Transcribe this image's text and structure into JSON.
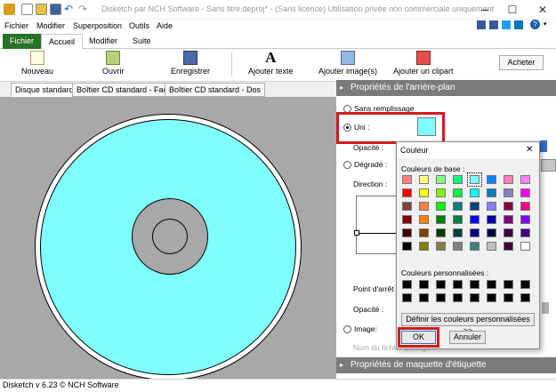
{
  "window": {
    "title": "Disketch par NCH Software - Sans titre.deproj* - (Sans licence) Utilisation privée non commerciale uniquement"
  },
  "menu": [
    "Fichier",
    "Modifier",
    "Superposition",
    "Outils",
    "Aide"
  ],
  "tabs": [
    "Fichier",
    "Accueil",
    "Modifier",
    "Suite"
  ],
  "ribbon": {
    "new": "Nouveau",
    "open": "Ouvrir",
    "save": "Enregistrer",
    "add_text": "Ajouter texte",
    "add_image": "Ajouter image(s)",
    "add_clipart": "Ajouter un clipart",
    "buy": "Acheter"
  },
  "doc_tabs": [
    "Disque standard",
    "Boîtier CD standard - Face",
    "Boîtier CD standard - Dos"
  ],
  "panel": {
    "bg_title": "Propriétés de l'arrière-plan",
    "no_fill": "Sans remplissage",
    "solid": "Uni :",
    "opacity": "Opacité :",
    "gradient": "Dégradé :",
    "direction": "Direction :",
    "stop_point": "Point d'arrêt :",
    "opacity2": "Opacité :",
    "image": "Image:",
    "filename": "Nom du fichier d'image",
    "label_title": "Propriétés de maquette d'étiquette"
  },
  "dialog": {
    "title": "Couleur",
    "base_colors": "Couleurs de base :",
    "custom_colors": "Couleurs personnalisées :",
    "define_button": "Définir les couleurs personnalisées >>",
    "ok": "OK",
    "cancel": "Annuler",
    "close": "✕"
  },
  "colors": {
    "disc": "#80ffff",
    "selected": "#80ffff",
    "file_tab": "#267226",
    "header": "#7b7b7b",
    "highlight": "#d01c1c",
    "base": [
      "#ff8080",
      "#ffff80",
      "#80ff80",
      "#00ff80",
      "#80ffff",
      "#0080ff",
      "#ff80c0",
      "#ff80ff",
      "#ff0000",
      "#ffff00",
      "#80ff00",
      "#00ff40",
      "#00ffff",
      "#0080c0",
      "#8080c0",
      "#ff00ff",
      "#804040",
      "#ff8040",
      "#00ff00",
      "#008080",
      "#004080",
      "#8080ff",
      "#800040",
      "#ff0080",
      "#800000",
      "#ff8000",
      "#008000",
      "#008040",
      "#0000ff",
      "#0000a0",
      "#800080",
      "#8000ff",
      "#400000",
      "#804000",
      "#004000",
      "#004040",
      "#000080",
      "#000040",
      "#400040",
      "#400080",
      "#000000",
      "#808000",
      "#808040",
      "#808080",
      "#408080",
      "#c0c0c0",
      "#400040",
      "#ffffff"
    ]
  },
  "status": "Disketch v 6.23 © NCH Software"
}
